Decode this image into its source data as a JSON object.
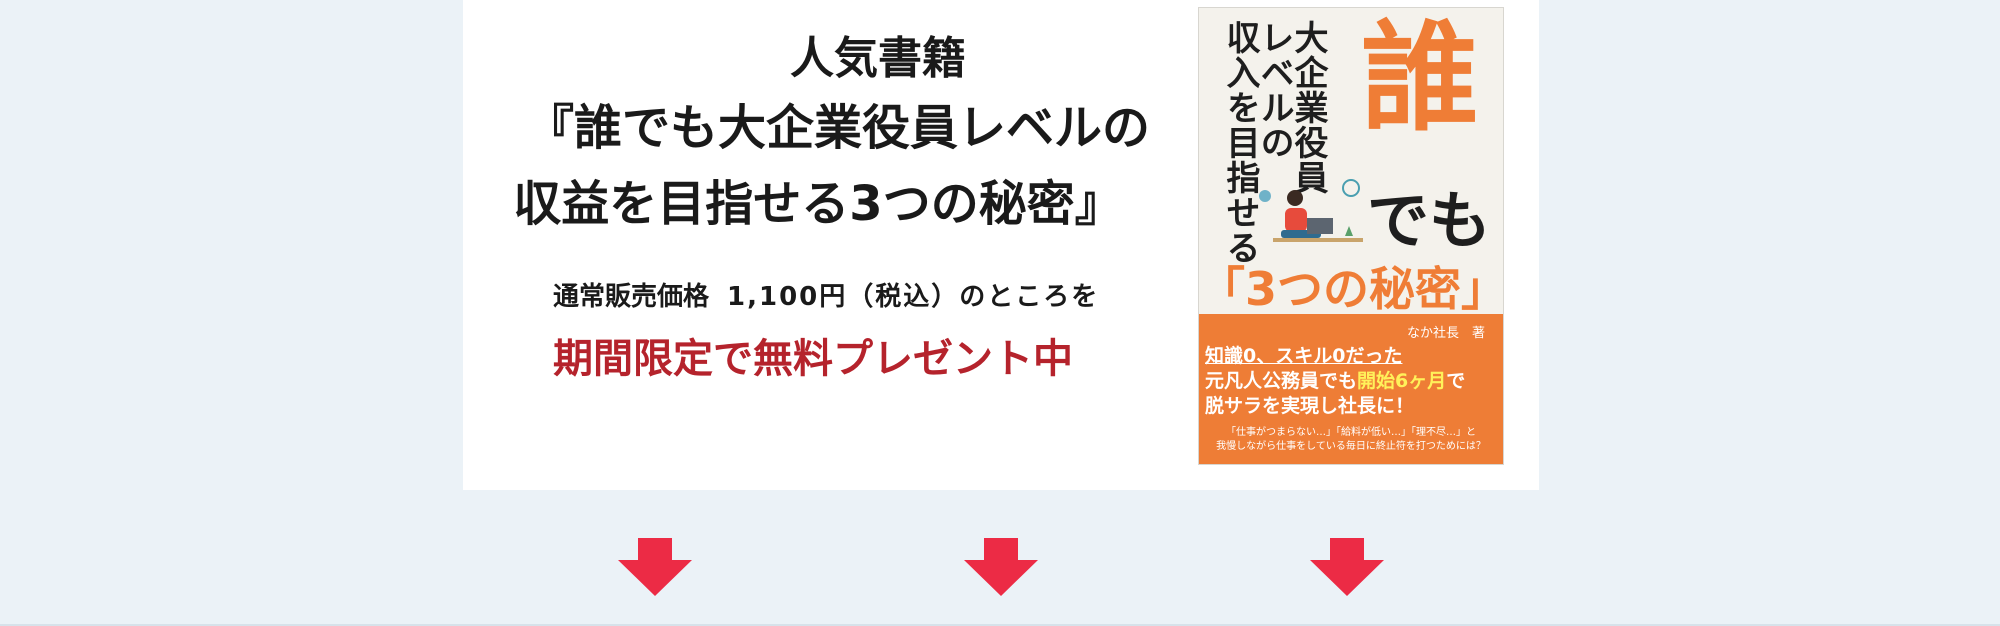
{
  "headline": {
    "line1": "人気書籍",
    "line2": "『誰でも大企業役員レベルの",
    "line3": "収益を目指せる3つの秘密』"
  },
  "price": {
    "label": "通常販売価格",
    "amount": "1,100円（税込）のところを"
  },
  "promo": "期間限定で無料プレゼント中",
  "book": {
    "title_col1": "大企業役員",
    "title_col2": "レベルの",
    "title_col3": "収入を目指せる",
    "big_char": "誰",
    "big_suffix": "でも",
    "subtitle": "「3つの秘密」",
    "author": "なか社長　著",
    "blurb_line1": "知識0、スキル0だった",
    "blurb_line2_a": "元凡人公務員でも",
    "blurb_line2_b": "開始6ヶ月",
    "blurb_line2_c": "で",
    "blurb_line3": "脱サラを実現し社長に！",
    "small_line1": "「仕事がつまらない…」「給料が低い…」「理不尽…」と",
    "small_line2": "我慢しながら仕事をしている毎日に終止符を打つためには？"
  },
  "colors": {
    "background": "#ebf2f7",
    "panel": "#ffffff",
    "accent_red": "#b5232c",
    "arrow": "#ec2b45",
    "book_orange": "#ee7d36"
  },
  "icons": [
    "down-arrow-icon",
    "down-arrow-icon",
    "down-arrow-icon"
  ]
}
